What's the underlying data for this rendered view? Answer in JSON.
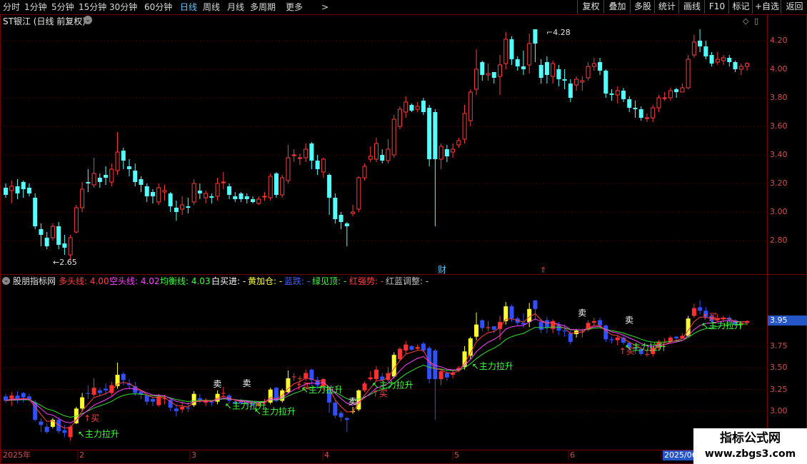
{
  "toolbar": {
    "timeframes": [
      "分时",
      "1分钟",
      "5分钟",
      "15分钟",
      "30分钟",
      "60分钟",
      "日线",
      "周线",
      "月线",
      "多周期",
      "更多"
    ],
    "active_timeframe": "日线",
    "right_buttons": [
      "复权",
      "叠加",
      "多股",
      "统计",
      "画线",
      "F10",
      "标记",
      "+自选",
      "返回"
    ]
  },
  "main_chart": {
    "title": "ST银江 (日线 前复权)",
    "high_label": "4.28",
    "low_label": "2.65",
    "event_label": "财",
    "y_ticks": [
      "4.20",
      "4.00",
      "3.80",
      "3.60",
      "3.40",
      "3.20",
      "3.00",
      "2.80"
    ]
  },
  "indicator": {
    "name": "股朋指标网",
    "items": [
      {
        "label": "多头线: 4.00",
        "color": "#ff4040"
      },
      {
        "label": "空头线: 4.02",
        "color": "#ff40ff"
      },
      {
        "label": "均衡线: 4.03",
        "color": "#40ff40"
      },
      {
        "label": "白买进: -",
        "color": "#ffffff"
      },
      {
        "label": "黄加仓: -",
        "color": "#ffff40"
      },
      {
        "label": "蓝跌: -",
        "color": "#4060ff"
      },
      {
        "label": "绿见顶: -",
        "color": "#40ff40"
      },
      {
        "label": "红强势: -",
        "color": "#ff4040"
      },
      {
        "label": "红蓝调整: -",
        "color": "#c0c0c0"
      }
    ],
    "y_ticks": [
      "3.75",
      "3.50",
      "3.25",
      "3.00"
    ],
    "current_value": "3.95",
    "signals": {
      "buy": "买",
      "sell": "卖",
      "main_rise": "主力拉升"
    }
  },
  "x_axis": {
    "labels": [
      "2025年",
      "2",
      "3",
      "4",
      "5",
      "6",
      "2025/06"
    ]
  },
  "watermark": {
    "line1": "指标公式网",
    "line2": "www.zbgs3.com"
  },
  "colors": {
    "up": "#ff3c3c",
    "down": "#54ffff",
    "border": "#7a0000",
    "active_tab": "#5fc8ff"
  },
  "chart_data": {
    "type": "candlestick",
    "series": [
      {
        "name": "K",
        "ohlc": [
          [
            3.17,
            3.12,
            3.2,
            3.1
          ],
          [
            3.15,
            3.18,
            3.22,
            3.06
          ],
          [
            3.18,
            3.13,
            3.23,
            3.09
          ],
          [
            3.21,
            3.16,
            3.22,
            3.1
          ],
          [
            3.17,
            3.13,
            3.2,
            3.11
          ],
          [
            3.1,
            2.9,
            3.13,
            2.88
          ],
          [
            2.88,
            2.84,
            2.92,
            2.76
          ],
          [
            2.82,
            2.76,
            2.86,
            2.74
          ],
          [
            2.82,
            2.9,
            2.92,
            2.8
          ],
          [
            2.9,
            2.77,
            2.93,
            2.74
          ],
          [
            2.78,
            2.75,
            2.84,
            2.7
          ],
          [
            2.7,
            2.82,
            2.84,
            2.66
          ],
          [
            2.86,
            3.03,
            3.05,
            2.85
          ],
          [
            3.03,
            3.16,
            3.21,
            3.0
          ],
          [
            3.21,
            3.2,
            3.3,
            3.14
          ],
          [
            3.19,
            3.27,
            3.38,
            3.17
          ],
          [
            3.24,
            3.21,
            3.27,
            3.17
          ],
          [
            3.26,
            3.24,
            3.32,
            3.19
          ],
          [
            3.21,
            3.3,
            3.34,
            3.18
          ],
          [
            3.29,
            3.42,
            3.56,
            3.26
          ],
          [
            3.43,
            3.36,
            3.45,
            3.3
          ],
          [
            3.32,
            3.3,
            3.37,
            3.25
          ],
          [
            3.29,
            3.21,
            3.34,
            3.18
          ],
          [
            3.23,
            3.19,
            3.25,
            3.14
          ],
          [
            3.18,
            3.11,
            3.2,
            3.07
          ],
          [
            3.14,
            3.11,
            3.16,
            3.06
          ],
          [
            3.07,
            3.17,
            3.2,
            3.05
          ],
          [
            3.14,
            3.15,
            3.19,
            3.08
          ],
          [
            3.13,
            3.04,
            3.14,
            3.0
          ],
          [
            3.03,
            3.0,
            3.08,
            2.94
          ],
          [
            3.02,
            3.05,
            3.11,
            2.98
          ],
          [
            3.04,
            3.03,
            3.1,
            2.99
          ],
          [
            3.07,
            3.2,
            3.23,
            3.05
          ],
          [
            3.15,
            3.13,
            3.2,
            3.09
          ],
          [
            3.1,
            3.13,
            3.15,
            3.06
          ],
          [
            3.11,
            3.1,
            3.13,
            3.06
          ],
          [
            3.11,
            3.2,
            3.24,
            3.08
          ],
          [
            3.21,
            3.21,
            3.28,
            3.16
          ],
          [
            3.18,
            3.12,
            3.2,
            3.09
          ],
          [
            3.11,
            3.09,
            3.14,
            3.07
          ],
          [
            3.13,
            3.09,
            3.14,
            3.07
          ],
          [
            3.11,
            3.09,
            3.13,
            3.06
          ],
          [
            3.09,
            3.07,
            3.11,
            3.06
          ],
          [
            3.06,
            3.09,
            3.11,
            3.05
          ],
          [
            3.11,
            3.11,
            3.14,
            3.08
          ],
          [
            3.1,
            3.25,
            3.27,
            3.08
          ],
          [
            3.27,
            3.12,
            3.28,
            3.1
          ],
          [
            3.12,
            3.24,
            3.26,
            3.1
          ],
          [
            3.22,
            3.38,
            3.47,
            3.2
          ],
          [
            3.4,
            3.4,
            3.44,
            3.35
          ],
          [
            3.38,
            3.38,
            3.41,
            3.33
          ],
          [
            3.38,
            3.44,
            3.48,
            3.35
          ],
          [
            3.48,
            3.36,
            3.49,
            3.3
          ],
          [
            3.36,
            3.3,
            3.4,
            3.26
          ],
          [
            3.28,
            3.37,
            3.38,
            3.24
          ],
          [
            3.26,
            3.1,
            3.27,
            2.98
          ],
          [
            3.1,
            2.95,
            3.13,
            2.92
          ],
          [
            2.98,
            2.93,
            3.0,
            2.88
          ],
          [
            2.92,
            2.9,
            2.93,
            2.76
          ],
          [
            2.99,
            3.0,
            3.05,
            2.97
          ],
          [
            3.02,
            3.24,
            3.25,
            3.0
          ],
          [
            3.24,
            3.32,
            3.34,
            3.22
          ],
          [
            3.37,
            3.39,
            3.46,
            3.35
          ],
          [
            3.37,
            3.48,
            3.52,
            3.35
          ],
          [
            3.4,
            3.36,
            3.44,
            3.34
          ],
          [
            3.36,
            3.44,
            3.51,
            3.34
          ],
          [
            3.4,
            3.65,
            3.68,
            3.38
          ],
          [
            3.6,
            3.72,
            3.74,
            3.58
          ],
          [
            3.7,
            3.77,
            3.81,
            3.66
          ],
          [
            3.75,
            3.71,
            3.76,
            3.7
          ],
          [
            3.72,
            3.74,
            3.77,
            3.7
          ],
          [
            3.78,
            3.7,
            3.8,
            3.68
          ],
          [
            3.73,
            3.37,
            3.75,
            3.32
          ],
          [
            3.7,
            3.37,
            3.72,
            2.9
          ],
          [
            3.37,
            3.46,
            3.48,
            3.3
          ],
          [
            3.44,
            3.39,
            3.47,
            3.35
          ],
          [
            3.42,
            3.44,
            3.48,
            3.38
          ],
          [
            3.47,
            3.5,
            3.52,
            3.45
          ],
          [
            3.51,
            3.69,
            3.75,
            3.48
          ],
          [
            3.64,
            3.84,
            3.86,
            3.6
          ],
          [
            3.86,
            4.0,
            4.14,
            3.82
          ],
          [
            4.05,
            3.96,
            4.06,
            3.92
          ],
          [
            3.96,
            3.97,
            4.04,
            3.92
          ],
          [
            3.98,
            3.94,
            3.98,
            3.9
          ],
          [
            3.95,
            4.03,
            4.1,
            3.82
          ],
          [
            4.04,
            4.21,
            4.26,
            4.0
          ],
          [
            4.21,
            4.07,
            4.23,
            4.03
          ],
          [
            4.07,
            4.02,
            4.09,
            3.99
          ],
          [
            4.02,
            4.0,
            4.13,
            3.96
          ],
          [
            4.03,
            4.18,
            4.25,
            3.97
          ],
          [
            4.28,
            4.18,
            4.28,
            4.05
          ],
          [
            4.03,
            3.94,
            4.07,
            3.9
          ],
          [
            4.05,
            3.96,
            4.09,
            3.9
          ],
          [
            3.95,
            4.04,
            4.06,
            3.9
          ],
          [
            4.0,
            3.93,
            4.03,
            3.88
          ],
          [
            3.93,
            3.92,
            4.0,
            3.86
          ],
          [
            3.9,
            3.8,
            3.93,
            3.77
          ],
          [
            3.89,
            3.93,
            3.95,
            3.85
          ],
          [
            3.91,
            3.92,
            3.95,
            3.85
          ],
          [
            3.94,
            4.02,
            4.05,
            3.92
          ],
          [
            4.02,
            4.04,
            4.08,
            3.99
          ],
          [
            4.05,
            3.99,
            4.08,
            3.96
          ],
          [
            3.99,
            3.83,
            4.0,
            3.8
          ],
          [
            3.83,
            3.82,
            3.86,
            3.78
          ],
          [
            3.82,
            3.85,
            3.88,
            3.76
          ],
          [
            3.85,
            3.79,
            3.87,
            3.77
          ],
          [
            3.79,
            3.73,
            3.81,
            3.7
          ],
          [
            3.73,
            3.72,
            3.78,
            3.66
          ],
          [
            3.72,
            3.66,
            3.74,
            3.64
          ],
          [
            3.66,
            3.66,
            3.69,
            3.63
          ],
          [
            3.66,
            3.73,
            3.75,
            3.63
          ],
          [
            3.73,
            3.8,
            3.82,
            3.7
          ],
          [
            3.8,
            3.8,
            3.84,
            3.78
          ],
          [
            3.8,
            3.85,
            3.87,
            3.78
          ],
          [
            3.86,
            3.84,
            3.87,
            3.8
          ],
          [
            3.84,
            3.87,
            3.9,
            3.84
          ],
          [
            3.87,
            4.07,
            4.1,
            3.86
          ],
          [
            4.1,
            4.19,
            4.24,
            4.08
          ],
          [
            4.2,
            4.16,
            4.28,
            4.12
          ],
          [
            4.16,
            4.09,
            4.2,
            4.07
          ],
          [
            4.1,
            4.04,
            4.12,
            4.02
          ],
          [
            4.05,
            4.07,
            4.12,
            4.03
          ],
          [
            4.06,
            4.08,
            4.1,
            4.03
          ],
          [
            4.08,
            4.05,
            4.1,
            4.02
          ],
          [
            4.05,
            4.0,
            4.06,
            3.98
          ],
          [
            4.0,
            4.02,
            4.04,
            3.96
          ],
          [
            4.02,
            4.04,
            4.05,
            3.99
          ]
        ]
      }
    ],
    "ylim": [
      2.62,
      4.33
    ],
    "y_ticks": [
      4.2,
      4.0,
      3.8,
      3.6,
      3.4,
      3.2,
      3.0,
      2.8
    ],
    "indicator_ylim": [
      2.78,
      4.25
    ],
    "indicator_ticks": [
      3.75,
      3.5,
      3.25,
      3.0
    ]
  }
}
